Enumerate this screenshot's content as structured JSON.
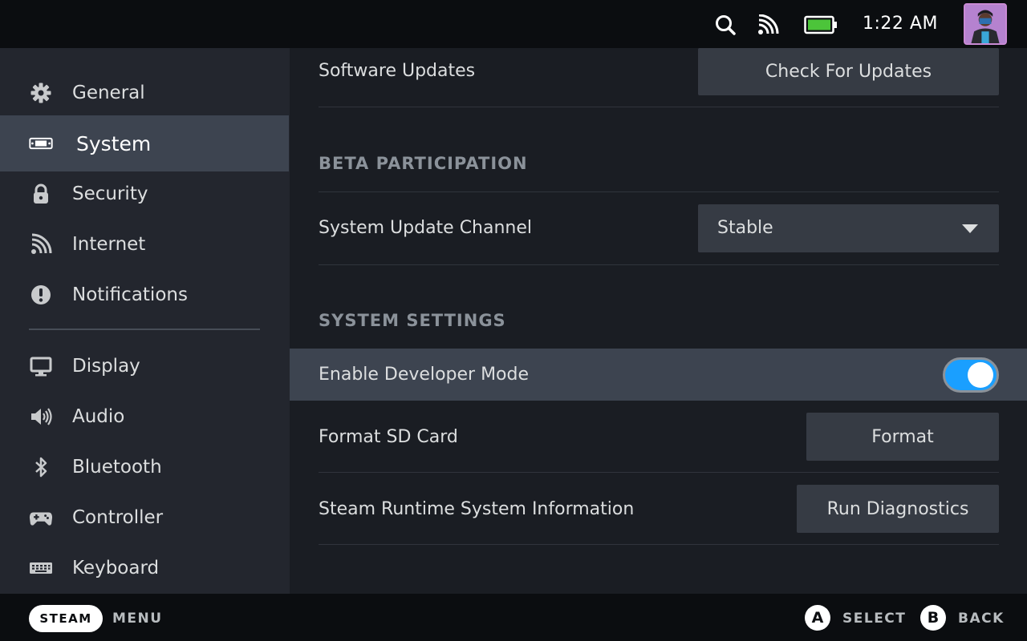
{
  "status_bar": {
    "time": "1:22 AM",
    "icons": [
      "search-icon",
      "wifi-icon",
      "battery-icon"
    ],
    "battery_level": 1.0
  },
  "sidebar": {
    "items": [
      {
        "label": "General",
        "icon": "gear-icon"
      },
      {
        "label": "System",
        "icon": "system-icon",
        "active": true
      },
      {
        "label": "Security",
        "icon": "lock-icon"
      },
      {
        "label": "Internet",
        "icon": "wifi-icon"
      },
      {
        "label": "Notifications",
        "icon": "alert-icon"
      },
      {
        "label": "Display",
        "icon": "monitor-icon"
      },
      {
        "label": "Audio",
        "icon": "speaker-icon"
      },
      {
        "label": "Bluetooth",
        "icon": "bluetooth-icon"
      },
      {
        "label": "Controller",
        "icon": "gamepad-icon"
      },
      {
        "label": "Keyboard",
        "icon": "keyboard-icon"
      }
    ]
  },
  "main": {
    "software_updates": {
      "label": "Software Updates",
      "button": "Check For Updates"
    },
    "beta_header": "BETA PARTICIPATION",
    "update_channel": {
      "label": "System Update Channel",
      "value": "Stable"
    },
    "system_header": "SYSTEM SETTINGS",
    "developer_mode": {
      "label": "Enable Developer Mode",
      "enabled": true
    },
    "format_sd": {
      "label": "Format SD Card",
      "button": "Format"
    },
    "runtime_info": {
      "label": "Steam Runtime System Information",
      "button": "Run Diagnostics"
    }
  },
  "footer": {
    "steam_label": "STEAM",
    "menu_label": "MENU",
    "a_glyph": "A",
    "a_label": "SELECT",
    "b_glyph": "B",
    "b_label": "BACK"
  },
  "colors": {
    "accent": "#1a9fff",
    "battery": "#4cc43a",
    "active_row": "#3d4450"
  }
}
